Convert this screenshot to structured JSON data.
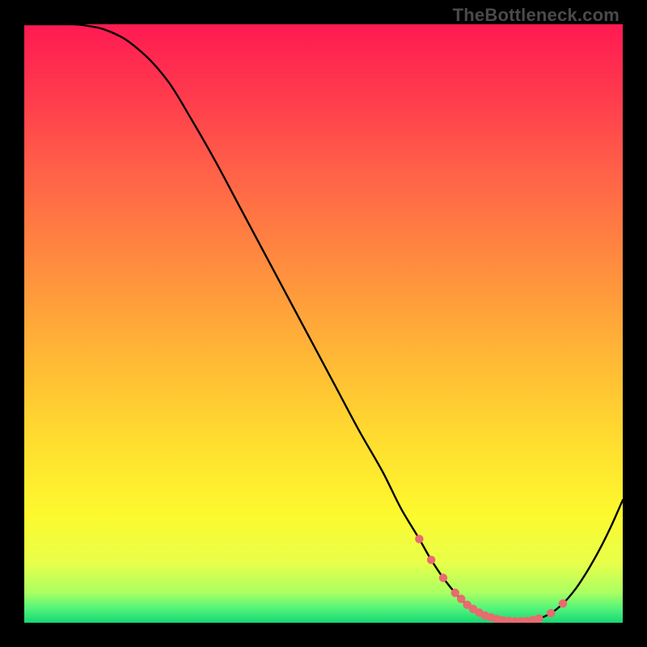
{
  "watermark": "TheBottleneck.com",
  "chart_data": {
    "type": "line",
    "title": "",
    "xlabel": "",
    "ylabel": "",
    "xlim": [
      0,
      100
    ],
    "ylim": [
      0,
      100
    ],
    "grid": false,
    "series": [
      {
        "name": "curve",
        "x": [
          0,
          4,
          8,
          12,
          16,
          20,
          24,
          28,
          32,
          36,
          40,
          44,
          48,
          52,
          56,
          60,
          63,
          66,
          68,
          70,
          72,
          74,
          76,
          78,
          80,
          82,
          84,
          86,
          88,
          90,
          92,
          94,
          96,
          98,
          100
        ],
        "values": [
          100,
          100,
          100,
          99.5,
          98,
          95,
          90.5,
          84,
          77,
          69.5,
          62,
          54.5,
          47,
          39.5,
          32,
          25,
          19,
          14,
          10.5,
          7.5,
          5,
          3,
          1.7,
          0.9,
          0.4,
          0.25,
          0.3,
          0.7,
          1.6,
          3.2,
          5.5,
          8.5,
          12,
          16,
          20.5
        ]
      }
    ],
    "markers": {
      "name": "highlight-points",
      "color": "#e96a6f",
      "x": [
        66,
        68,
        70,
        72,
        73,
        74,
        75,
        76,
        77,
        78,
        79,
        80,
        81,
        82,
        83,
        84,
        85,
        86,
        88,
        90
      ],
      "values": [
        14,
        10.5,
        7.5,
        5,
        4,
        3,
        2.3,
        1.7,
        1.2,
        0.9,
        0.6,
        0.4,
        0.3,
        0.25,
        0.25,
        0.3,
        0.45,
        0.7,
        1.6,
        3.2
      ]
    },
    "gradient_stops": [
      {
        "offset": 0.0,
        "color": "#ff1a52"
      },
      {
        "offset": 0.12,
        "color": "#ff3b4d"
      },
      {
        "offset": 0.25,
        "color": "#ff6248"
      },
      {
        "offset": 0.4,
        "color": "#ff8c3f"
      },
      {
        "offset": 0.55,
        "color": "#ffb636"
      },
      {
        "offset": 0.7,
        "color": "#ffde2f"
      },
      {
        "offset": 0.82,
        "color": "#fdf92e"
      },
      {
        "offset": 0.9,
        "color": "#e8ff4a"
      },
      {
        "offset": 0.95,
        "color": "#aaff62"
      },
      {
        "offset": 0.975,
        "color": "#56f57a"
      },
      {
        "offset": 1.0,
        "color": "#16d873"
      }
    ]
  }
}
